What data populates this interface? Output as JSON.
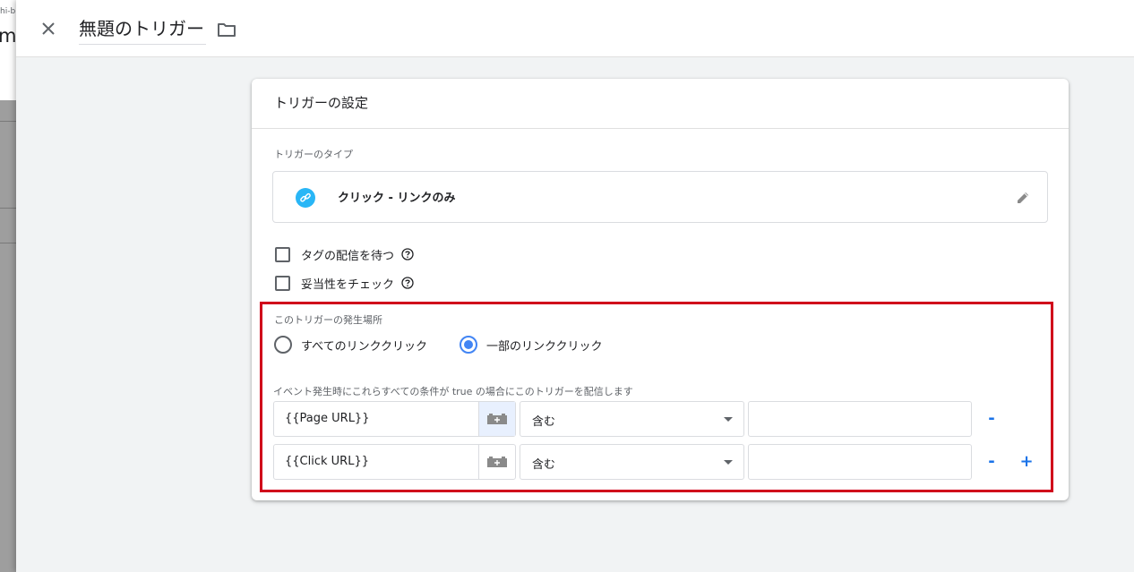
{
  "background": {
    "sub_text": "hi-b",
    "big_text": "m"
  },
  "header": {
    "title": "無題のトリガー",
    "close_icon": "close-icon",
    "folder_icon": "folder-icon"
  },
  "card": {
    "title": "トリガーの設定",
    "type_section": {
      "label": "トリガーのタイプ",
      "type_name": "クリック - リンクのみ",
      "icon": "link-icon",
      "edit_icon": "pencil-icon"
    },
    "checkboxes": [
      {
        "label": "タグの配信を待つ",
        "checked": false
      },
      {
        "label": "妥当性をチェック",
        "checked": false
      }
    ],
    "fire_on": {
      "label": "このトリガーの発生場所",
      "options": [
        {
          "label": "すべてのリンククリック",
          "checked": false
        },
        {
          "label": "一部のリンククリック",
          "checked": true
        }
      ]
    },
    "conditions": {
      "label": "イベント発生時にこれらすべての条件が true の場合にこのトリガーを配信します",
      "rows": [
        {
          "variable": "{{Page URL}}",
          "operator": "含む",
          "value": "",
          "remove": "-",
          "add": ""
        },
        {
          "variable": "{{Click URL}}",
          "operator": "含む",
          "value": "",
          "remove": "-",
          "add": "+"
        }
      ]
    }
  },
  "colors": {
    "accent": "#4285f4",
    "link_blue": "#1a73e8",
    "highlight_red": "#d0021b",
    "type_icon_bg": "#29b6f6"
  }
}
